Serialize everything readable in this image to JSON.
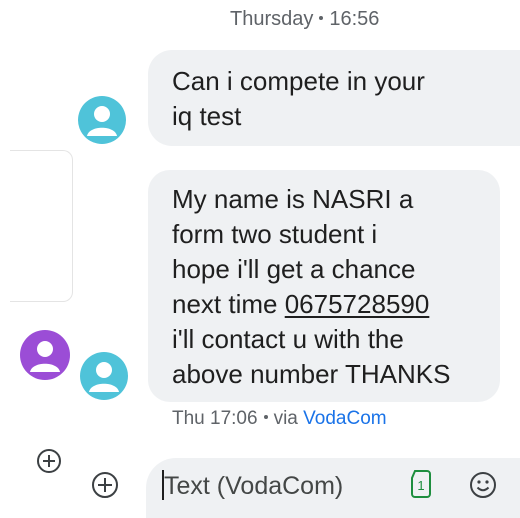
{
  "conversation": {
    "date_header": {
      "day": "Thursday",
      "time": "16:56"
    },
    "messages": [
      {
        "lines": [
          "Can i compete in your",
          "iq test"
        ]
      },
      {
        "lines": [
          "My name is NASRI a",
          "form two student i",
          "hope i'll get a chance"
        ],
        "line4_prefix": "next time ",
        "phone": "0675728590",
        "lines_after": [
          "i'll contact u with the",
          "above number THANKS"
        ]
      }
    ],
    "last_meta": {
      "time": "Thu 17:06",
      "via_prefix": "via",
      "carrier": "VodaCom"
    }
  },
  "composer": {
    "placeholder": "Text (VodaCom)",
    "sim_slot": "1"
  },
  "colors": {
    "bubble": "#eff1f3",
    "avatar": "#4fc3d9",
    "other_avatar": "#9b4dd6",
    "link": "#1a73e8"
  }
}
